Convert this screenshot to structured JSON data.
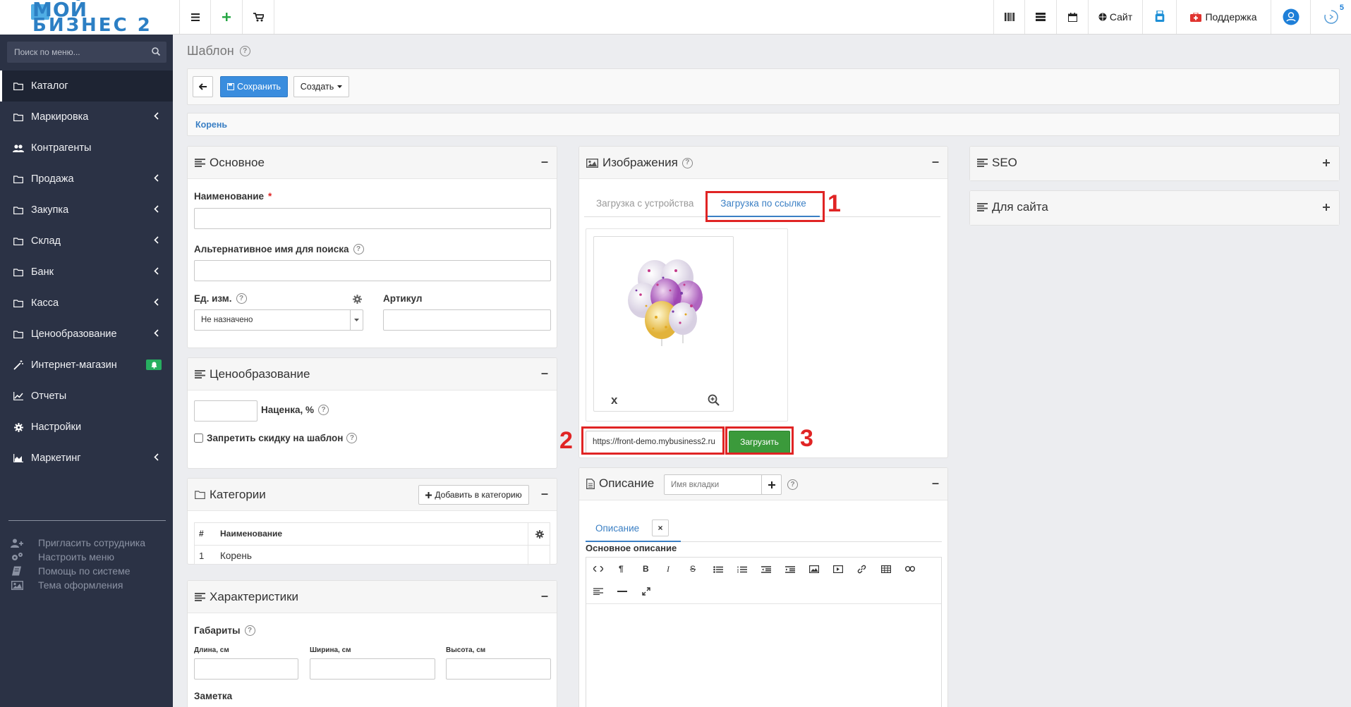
{
  "topbar": {
    "logo_line1": "МОЙ",
    "logo_line2": "БИЗНЕС 2",
    "site_label": "Сайт",
    "support_label": "Поддержка",
    "notifications_count": "5"
  },
  "sidebar": {
    "search_placeholder": "Поиск по меню...",
    "items": [
      {
        "label": "Каталог",
        "icon": "folder-icon"
      },
      {
        "label": "Маркировка",
        "icon": "folder-icon"
      },
      {
        "label": "Контрагенты",
        "icon": "users-icon"
      },
      {
        "label": "Продажа",
        "icon": "folder-icon"
      },
      {
        "label": "Закупка",
        "icon": "folder-icon"
      },
      {
        "label": "Склад",
        "icon": "folder-icon"
      },
      {
        "label": "Банк",
        "icon": "folder-icon"
      },
      {
        "label": "Касса",
        "icon": "folder-icon"
      },
      {
        "label": "Ценообразование",
        "icon": "folder-icon"
      },
      {
        "label": "Интернет-магазин",
        "icon": "magic-wand-icon"
      },
      {
        "label": "Отчеты",
        "icon": "line-chart-icon"
      },
      {
        "label": "Настройки",
        "icon": "gear-icon"
      },
      {
        "label": "Маркетинг",
        "icon": "area-chart-icon"
      }
    ],
    "extras": [
      {
        "label": "Пригласить сотрудника"
      },
      {
        "label": "Настроить меню"
      },
      {
        "label": "Помощь по системе"
      },
      {
        "label": "Тема оформления"
      }
    ]
  },
  "page": {
    "title": "Шаблон",
    "save_label": "Сохранить",
    "create_label": "Создать",
    "breadcrumb": "Корень"
  },
  "basic": {
    "title": "Основное",
    "name_label": "Наименование",
    "name_required": "*",
    "name_value": "",
    "alt_name_label": "Альтернативное имя для поиска",
    "alt_name_value": "",
    "unit_label": "Ед. изм.",
    "unit_value": "Не назначено",
    "article_label": "Артикул",
    "article_value": ""
  },
  "pricing": {
    "title": "Ценообразование",
    "markup_label": "Наценка, %",
    "markup_value": "",
    "no_discount_label": "Запретить скидку на шаблон",
    "no_discount_checked": false
  },
  "categories": {
    "title": "Категории",
    "add_label": "Добавить в категорию",
    "columns": [
      "#",
      "Наименование"
    ],
    "rows": [
      {
        "num": "1",
        "name": "Корень"
      }
    ]
  },
  "characteristics": {
    "title": "Характеристики",
    "dims_label": "Габариты",
    "length_label": "Длина, см",
    "width_label": "Ширина, см",
    "height_label": "Высота, см",
    "note_label": "Заметка"
  },
  "images": {
    "title": "Изображения",
    "tab_device": "Загрузка с устройства",
    "tab_url": "Загрузка по ссылке",
    "remove_label": "x",
    "url_value": "https://front-demo.mybusiness2.ru",
    "upload_label": "Загрузить",
    "annotations": [
      "1",
      "2",
      "3"
    ]
  },
  "description": {
    "title": "Описание",
    "tab_name_placeholder": "Имя вкладки",
    "tab_label": "Описание",
    "tab_close": "×",
    "main_label": "Основное описание",
    "toolbar": [
      "<>",
      "¶",
      "B",
      "I",
      "S",
      "ul",
      "ol",
      "outdent",
      "indent",
      "image",
      "video",
      "link",
      "table",
      "unlink",
      "align",
      "hr",
      "fullscreen"
    ]
  },
  "right": {
    "seo_title": "SEO",
    "site_title": "Для сайта"
  },
  "colors": {
    "sidebar_bg": "#2b3245",
    "primary": "#3a8dde",
    "success": "#3b9a3b",
    "annotation": "#e02424"
  }
}
